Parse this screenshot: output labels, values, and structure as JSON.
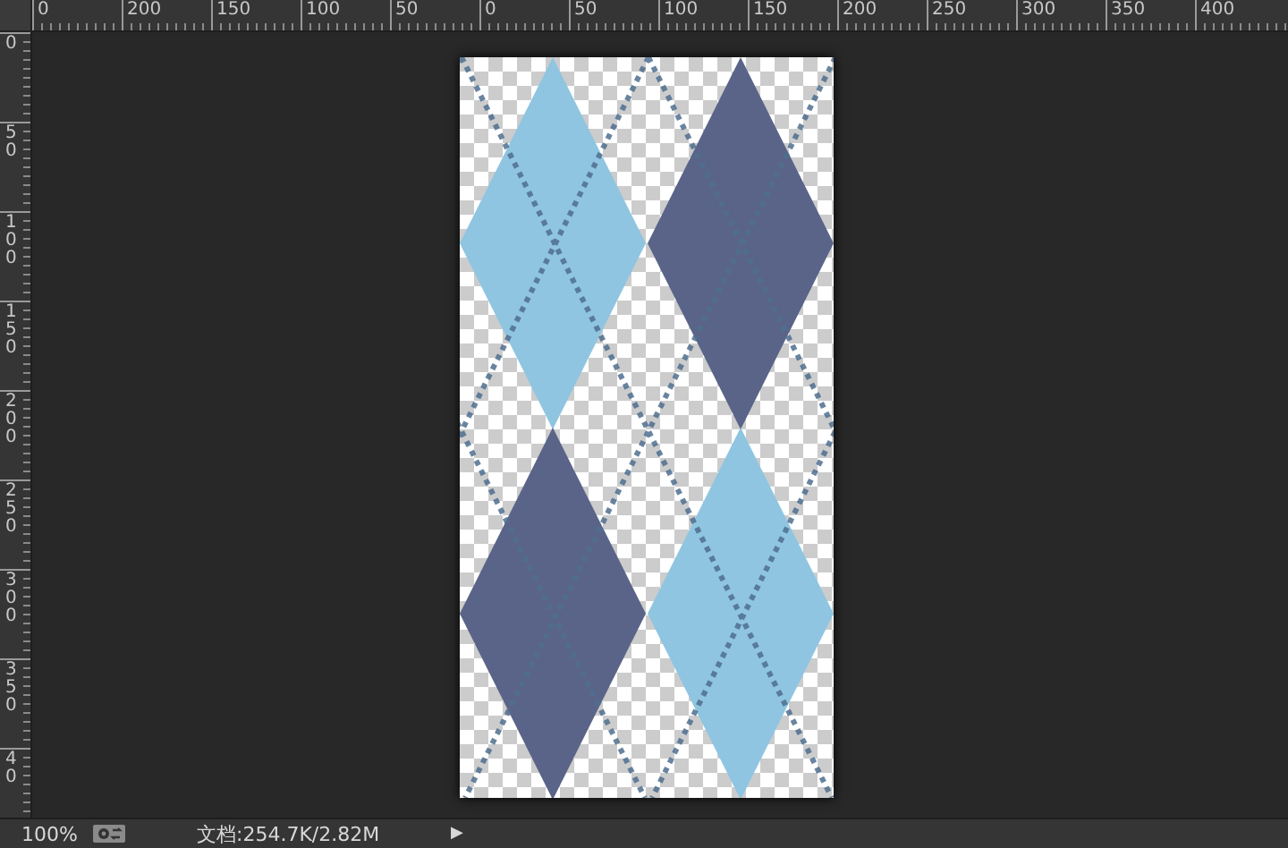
{
  "horizontal_ruler": {
    "labels": [
      "0",
      "200",
      "150",
      "100",
      "50",
      "0",
      "50",
      "100",
      "150",
      "200",
      "250",
      "300",
      "350",
      "400"
    ]
  },
  "vertical_ruler": {
    "labels": [
      "0",
      "50",
      "100",
      "150",
      "200",
      "250",
      "300",
      "350",
      "40"
    ]
  },
  "status_bar": {
    "zoom": "100%",
    "document_size": "文档:254.7K/2.82M",
    "arrow": "▶"
  }
}
